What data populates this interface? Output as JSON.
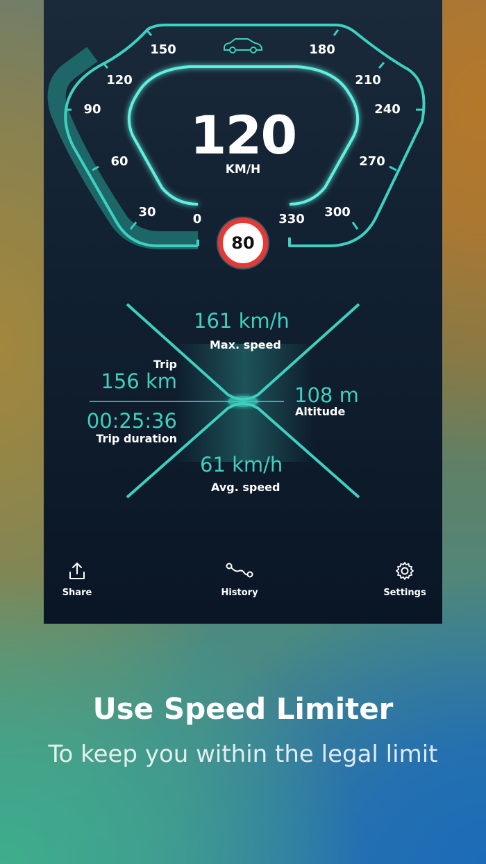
{
  "speedometer": {
    "current_speed": "120",
    "unit": "KM/H",
    "speed_limit": "80",
    "scale_labels": [
      "0",
      "30",
      "60",
      "90",
      "120",
      "150",
      "180",
      "210",
      "240",
      "270",
      "300",
      "330"
    ],
    "progress_speed": 120,
    "max_scale": 330
  },
  "stats": {
    "max_speed": {
      "value": "161 km/h",
      "label": "Max. speed"
    },
    "trip": {
      "label": "Trip",
      "value": "156 km"
    },
    "trip_duration": {
      "value": "00:25:36",
      "label": "Trip duration"
    },
    "altitude": {
      "value": "108 m",
      "label": "Altitude"
    },
    "avg_speed": {
      "value": "61 km/h",
      "label": "Avg. speed"
    }
  },
  "nav": {
    "share": {
      "label": "Share",
      "icon": "share-icon"
    },
    "history": {
      "label": "History",
      "icon": "route-icon"
    },
    "settings": {
      "label": "Settings",
      "icon": "gear-icon"
    }
  },
  "promo": {
    "headline": "Use Speed Limiter",
    "subline": "To keep you within the legal limit"
  },
  "colors": {
    "accent": "#3ed0c0",
    "limit_red": "#e53935",
    "panel": "#112030"
  }
}
